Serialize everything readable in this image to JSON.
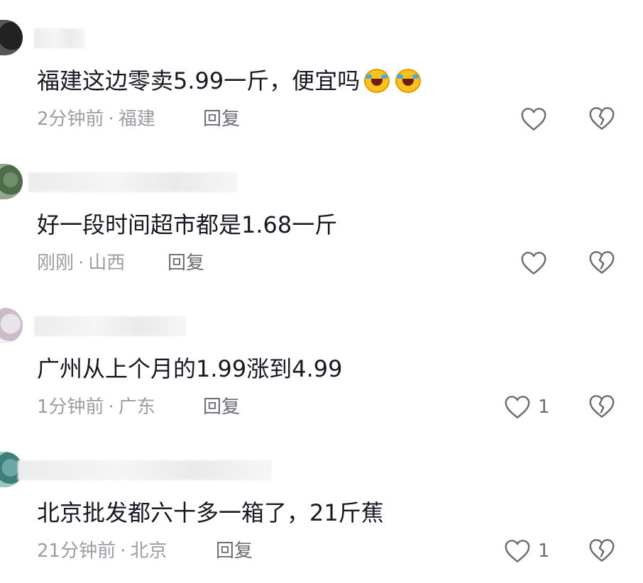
{
  "comments": [
    {
      "text": "福建这边零卖5.99一斤，便宜吗",
      "emoji": [
        "rolling-laughing-emoji",
        "rolling-laughing-emoji"
      ],
      "time": "2分钟前",
      "location": "福建",
      "reply_label": "回复",
      "like_count": ""
    },
    {
      "text": "好一段时间超市都是1.68一斤",
      "emoji": [],
      "time": "刚刚",
      "location": "山西",
      "reply_label": "回复",
      "like_count": ""
    },
    {
      "text": "广州从上个月的1.99涨到4.99",
      "emoji": [],
      "time": "1分钟前",
      "location": "广东",
      "reply_label": "回复",
      "like_count": "1"
    },
    {
      "text": "北京批发都六十多一箱了，21斤蕉",
      "emoji": [],
      "time": "21分钟前",
      "location": "北京",
      "reply_label": "回复",
      "like_count": "1"
    }
  ],
  "separator": "·",
  "colors": {
    "text": "#161823",
    "meta": "#9c9da3",
    "icon": "#6b6d74"
  },
  "icons": {
    "like": "heart-outline-icon",
    "dislike": "broken-heart-icon"
  }
}
